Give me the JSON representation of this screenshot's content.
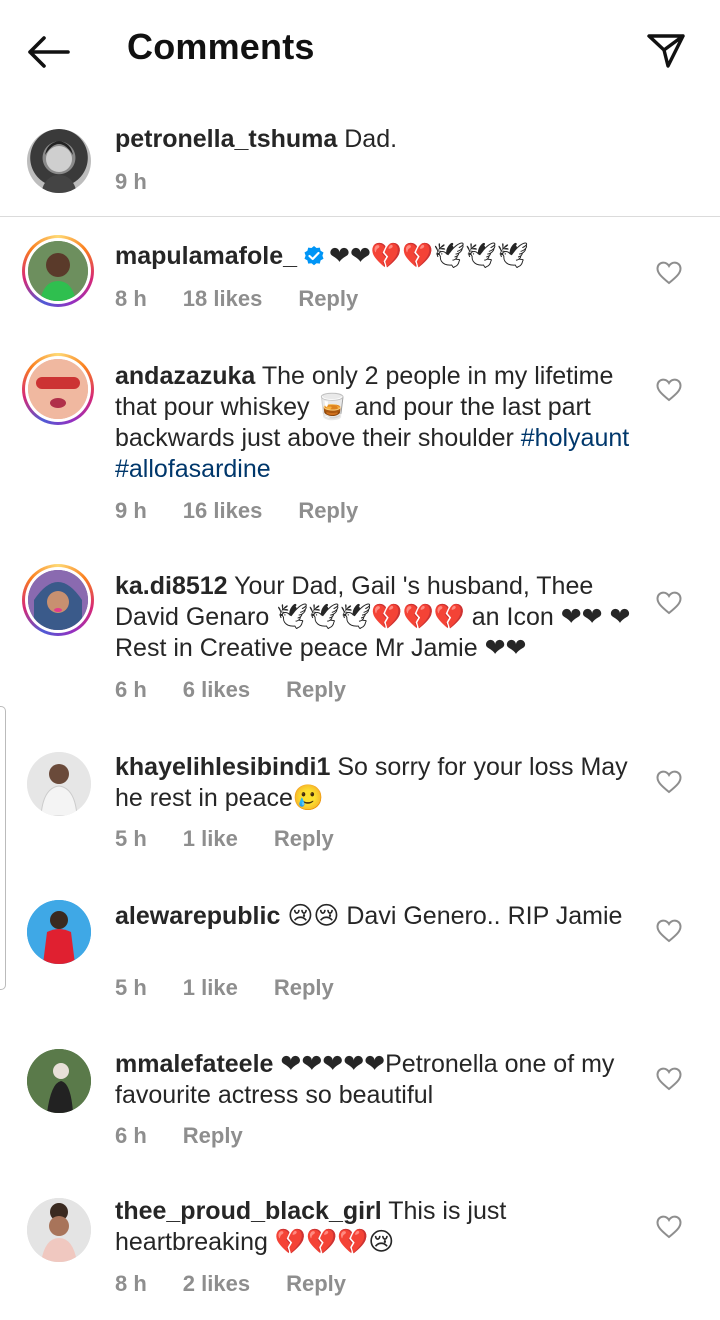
{
  "header": {
    "title": "Comments"
  },
  "caption": {
    "username": "petronella_tshuma",
    "text": "Dad.",
    "time": "9 h"
  },
  "comments": [
    {
      "username": "mapulamafole_",
      "verified": true,
      "text": "",
      "emoji": "❤❤💔💔🕊🕊🕊",
      "hashtags": "",
      "time": "8 h",
      "likes": "18 likes",
      "reply": "Reply"
    },
    {
      "username": "andazazuka",
      "text": "The only 2 people in my lifetime that pour whiskey 🥃 and pour the last part backwards just above their shoulder",
      "hashtags": "#holyaunt #allofasardine",
      "time": "9 h",
      "likes": "16 likes",
      "reply": "Reply"
    },
    {
      "username": "ka.di8512",
      "text": "Your Dad, Gail 's husband, Thee David Genaro 🕊🕊🕊💔💔💔 an Icon ❤❤ ❤ Rest in Creative peace  Mr Jamie ❤❤",
      "time": "6 h",
      "likes": "6 likes",
      "reply": "Reply"
    },
    {
      "username": "khayelihlesibindi1",
      "text": "So sorry for your loss May he rest in peace🥲",
      "time": "5 h",
      "likes": "1 like",
      "reply": "Reply"
    },
    {
      "username": "alewarepublic",
      "text": "😢😢 Davi Genero.. RIP Jamie",
      "time": "5 h",
      "likes": "1 like",
      "reply": "Reply"
    },
    {
      "username": "mmalefateele",
      "text": "❤❤❤❤❤Petronella one of my favourite actress so beautiful",
      "time": "6 h",
      "likes": "",
      "reply": "Reply"
    },
    {
      "username": "thee_proud_black_girl",
      "text": "This is just heartbreaking 💔💔💔😢",
      "time": "8 h",
      "likes": "2 likes",
      "reply": "Reply"
    }
  ],
  "colors": {
    "accent": "#0095f6",
    "hashtag": "#00376b",
    "muted": "#8e8e8e"
  }
}
